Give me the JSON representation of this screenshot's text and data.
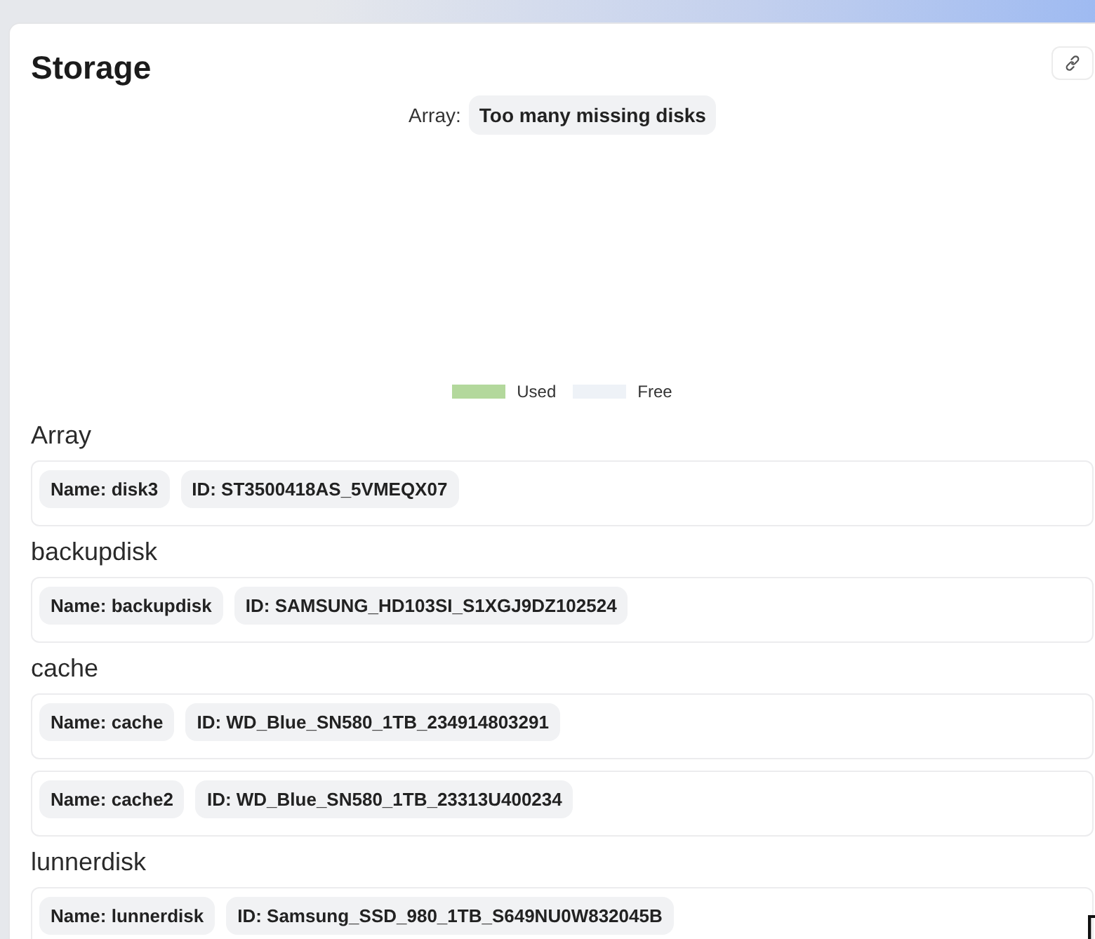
{
  "header": {
    "title": "Storage"
  },
  "status": {
    "label": "Array:",
    "value": "Too many missing disks"
  },
  "legend": [
    {
      "label": "Used",
      "color": "#b3d89c"
    },
    {
      "label": "Free",
      "color": "#eef2f7"
    }
  ],
  "groups": [
    {
      "name": "Array",
      "disks": [
        {
          "name": "Name: disk3",
          "id": "ID: ST3500418AS_5VMEQX07"
        }
      ]
    },
    {
      "name": "backupdisk",
      "disks": [
        {
          "name": "Name: backupdisk",
          "id": "ID: SAMSUNG_HD103SI_S1XGJ9DZ102524"
        }
      ]
    },
    {
      "name": "cache",
      "disks": [
        {
          "name": "Name: cache",
          "id": "ID: WD_Blue_SN580_1TB_234914803291"
        },
        {
          "name": "Name: cache2",
          "id": "ID: WD_Blue_SN580_1TB_23313U400234"
        }
      ]
    },
    {
      "name": "lunnerdisk",
      "disks": [
        {
          "name": "Name: lunnerdisk",
          "id": "ID: Samsung_SSD_980_1TB_S649NU0W832045B"
        }
      ]
    }
  ]
}
